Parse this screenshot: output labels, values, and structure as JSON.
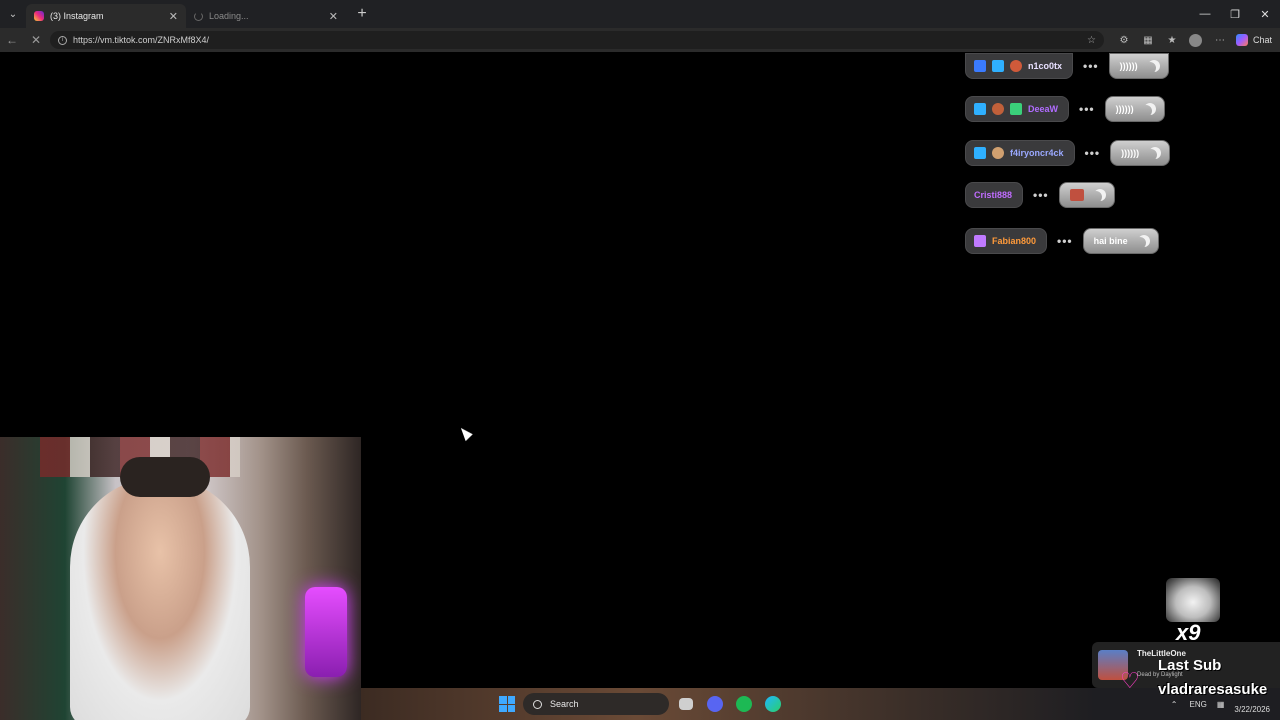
{
  "browser": {
    "tabs": [
      {
        "title": "(3) Instagram",
        "state": "active"
      },
      {
        "title": "Loading...",
        "state": "loading"
      }
    ],
    "new_tab_label": "+",
    "url": "https://vm.tiktok.com/ZNRxMf8X4/",
    "chat_label": "Chat"
  },
  "chat_overlay": {
    "messages": [
      {
        "user": "n1co0tx",
        "user_color": "#e8e0ff",
        "text": "))))))",
        "badges": [
          "#3a7bff",
          "#2fb0ff",
          "#d05a3a"
        ]
      },
      {
        "user": "DeeaW",
        "user_color": "#b06cff",
        "text": "))))))",
        "badges": [
          "#2fb0ff",
          "#c0603a",
          "#3ad07a"
        ]
      },
      {
        "user": "f4iryoncr4ck",
        "user_color": "#9aa8ff",
        "text": "))))))",
        "badges": [
          "#2fb0ff",
          "#d0a070"
        ]
      },
      {
        "user": "Cristi888",
        "user_color": "#c06cff",
        "text": "",
        "badges": []
      },
      {
        "user": "Fabian800",
        "user_color": "#ff9a3a",
        "text": "hai bine",
        "badges": [
          "#c07aff"
        ]
      }
    ]
  },
  "taskbar": {
    "search_label": "Search",
    "lang": "ENG",
    "date": "3/22/2026"
  },
  "alerts": {
    "multiplier": "x9",
    "sub_user_top": "TheLittleOne",
    "sub_game": "Dead by Daylight",
    "last_sub_label": "Last Sub",
    "last_sub_user": "vladraresasuke"
  },
  "colors": {
    "chrome_bg": "#202124",
    "addr_bg": "#2b2b2b",
    "accent_pink": "#ff3ec8",
    "mic_glow": "#d23cff"
  },
  "icons": [
    "chevron-down-icon",
    "instagram-icon",
    "loading-icon",
    "close-icon",
    "back-icon",
    "reload-icon",
    "info-icon",
    "star-icon",
    "extensions-icon",
    "favorites-icon",
    "profile-icon",
    "more-icon",
    "copilot-icon",
    "moon-icon",
    "windows-icon",
    "search-icon",
    "discord-icon",
    "spotify-icon",
    "edge-icon"
  ]
}
